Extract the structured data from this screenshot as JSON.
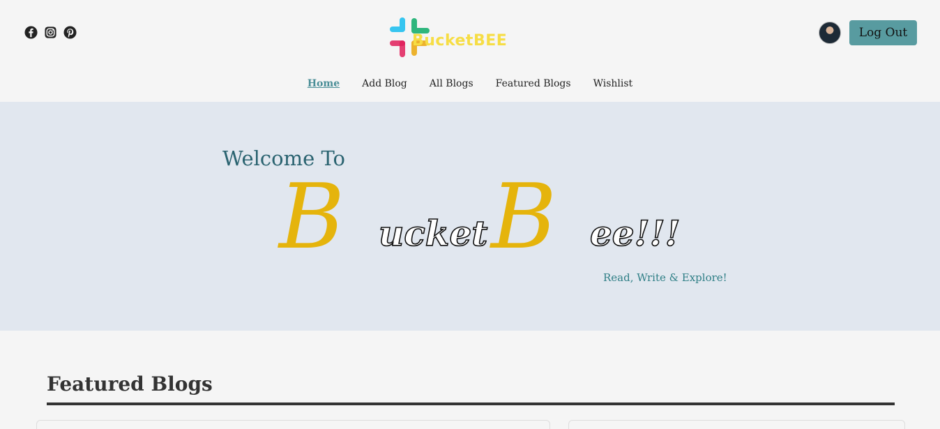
{
  "brand": {
    "logo_text": "BucketBEE",
    "colors": {
      "logo_text": "#f6dd45",
      "accent": "#589ba0",
      "hero_bg": "#e1e7ef",
      "gold": "#e5b40c"
    }
  },
  "socials": [
    {
      "icon": "facebook-icon"
    },
    {
      "icon": "instagram-icon"
    },
    {
      "icon": "pinterest-icon"
    }
  ],
  "user": {
    "logout_label": "Log Out"
  },
  "nav": {
    "items": [
      {
        "label": "Home",
        "active": true
      },
      {
        "label": "Add Blog"
      },
      {
        "label": "All Blogs"
      },
      {
        "label": "Featured Blogs"
      },
      {
        "label": "Wishlist"
      }
    ]
  },
  "hero": {
    "welcome": "Welcome To",
    "title_part1_initial": "B",
    "title_part1_rest": "ucket",
    "title_part2_initial": "B",
    "title_part2_rest": "ee!!!",
    "tagline": "Read, Write & Explore!"
  },
  "featured": {
    "title": "Featured Blogs"
  }
}
